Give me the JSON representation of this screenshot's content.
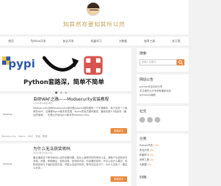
{
  "site": {
    "title": "知其然亦要知其所以然"
  },
  "nav": {
    "items": [
      "首页",
      "Python开发",
      "安全开发",
      "机器学习",
      "大数据",
      "效率工具",
      "关于我"
    ]
  },
  "banner": {
    "pypi_text": "pypi",
    "caption": "Python套路深，简单不简单"
  },
  "posts": [
    {
      "thumb_label": "loading...",
      "title": "自研WAF之路——Modsecurity安装教程",
      "date": "2021年06月18日",
      "excerpt": "Modsecurity全称Modsecurity起初是Apache服务器的一个开源模块，用于实现一个简单的WAF，后随着Nginx版本的发展，Nginx的官方模块集成，最新的是3.X的版本（最近的更新），也是从开始Nginx版本的Modsecurity...",
      "read_label": "阅读全文",
      "tags": "Modsecurity · Nginx · WAF · 安装 · 教程"
    },
    {
      "thumb_label": "loading...",
      "title": "为什么无法获奖密码",
      "date": "2021年05月22日",
      "excerpt": "最近遇到这个账号身份认证的设置问题，因为上面提供的所有的认证，被账户与密码存在未知，完整，明明确定，密码没有，密码的内容，你设置的密码，不论以及什么模式，特别说到该与下面的信息内容，完整以及如何有关。账号还会全中了，为什么没有人…要这么长说…",
      "read_label": "阅读全文",
      "tags": ""
    }
  ],
  "sidebar": {
    "search": {
      "title": "搜索",
      "placeholder": "请输入关键字"
    },
    "about": {
      "title": "网站公告",
      "lines": [
        "python安全知识分享",
        "关注我的公众号获取最新动态",
        "python/js编程"
      ]
    },
    "social": {
      "title": "社交"
    },
    "tags": {
      "title": "分类",
      "items": [
        {
          "name": "Python开发",
          "count": "(15)"
        },
        {
          "name": "安全开发",
          "count": "(8)"
        },
        {
          "name": "机器学习",
          "count": "(6)"
        },
        {
          "name": "效率工具",
          "count": "(4)"
        },
        {
          "name": "大数据",
          "count": "(3)"
        }
      ],
      "title2": "归档"
    }
  },
  "colors": {
    "accent": "#e8893b",
    "title_gold": "#c9a24f",
    "pypi_blue": "#2d5ca8"
  }
}
